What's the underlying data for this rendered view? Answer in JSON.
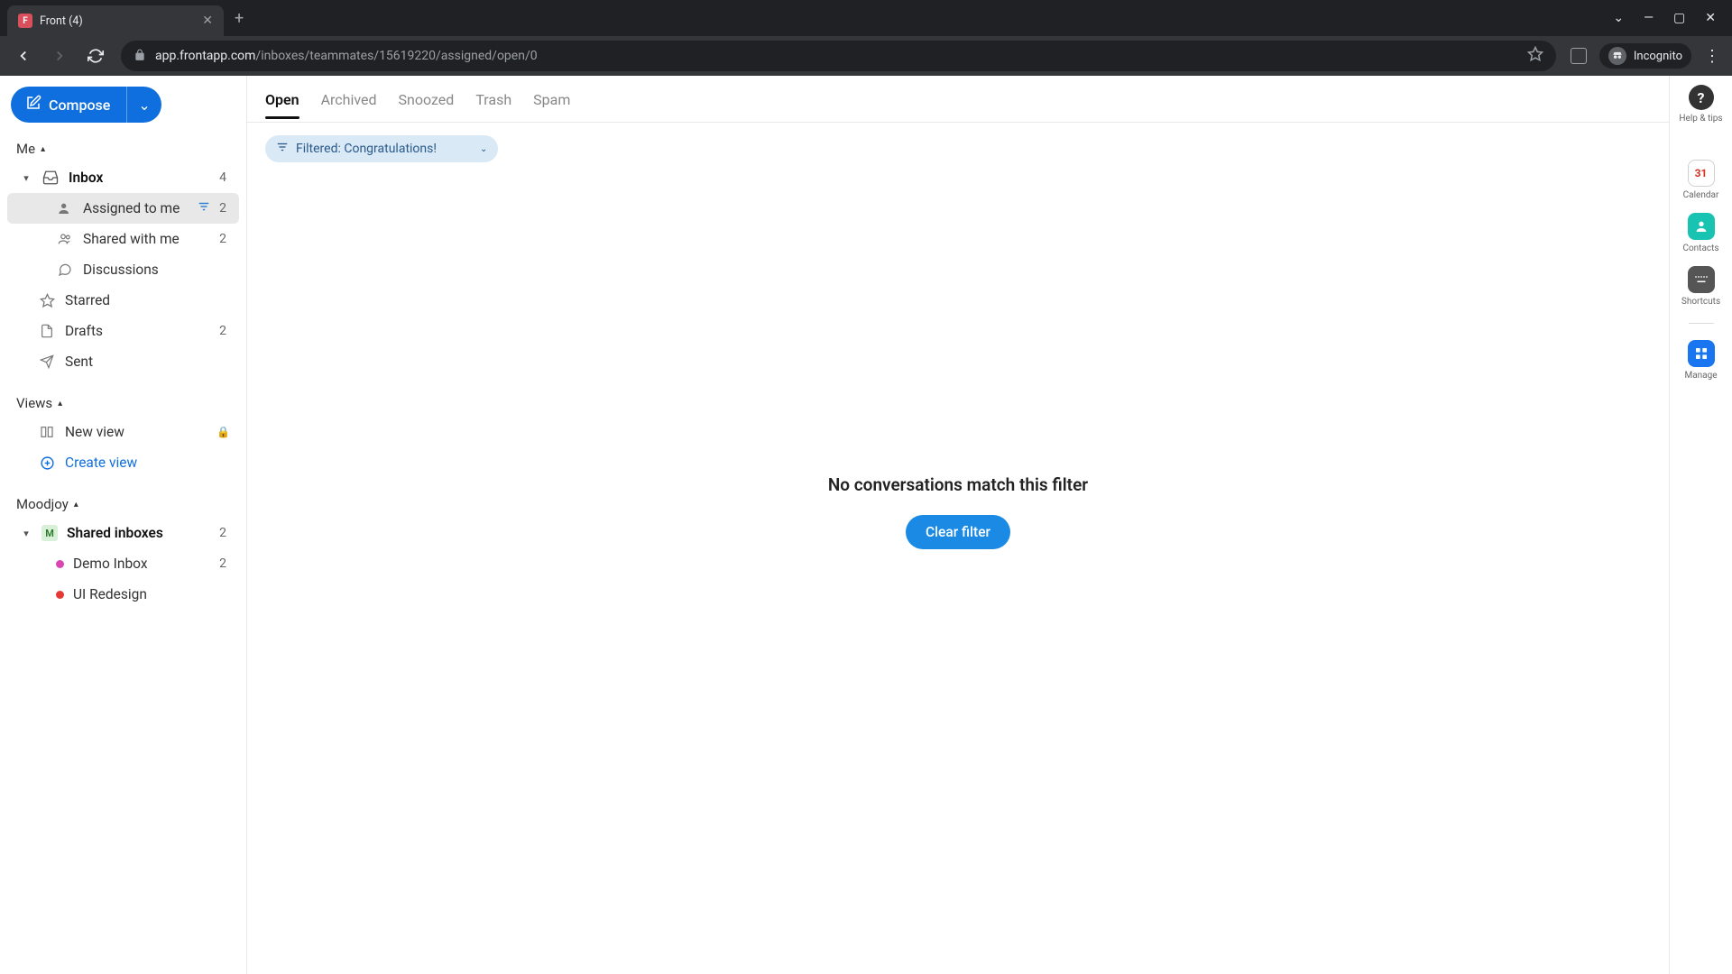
{
  "browser": {
    "tab_title": "Front (4)",
    "url_host": "app.frontapp.com",
    "url_path": "/inboxes/teammates/15619220/assigned/open/0",
    "incognito_label": "Incognito"
  },
  "sidebar": {
    "compose_label": "Compose",
    "sections": {
      "me": {
        "label": "Me"
      },
      "views": {
        "label": "Views"
      },
      "workspace": {
        "label": "Moodjoy"
      }
    },
    "inbox": {
      "label": "Inbox",
      "count": "4"
    },
    "assigned": {
      "label": "Assigned to me",
      "count": "2"
    },
    "shared_with_me": {
      "label": "Shared with me",
      "count": "2"
    },
    "discussions": {
      "label": "Discussions"
    },
    "starred": {
      "label": "Starred"
    },
    "drafts": {
      "label": "Drafts",
      "count": "2"
    },
    "sent": {
      "label": "Sent"
    },
    "new_view": {
      "label": "New view"
    },
    "create_view": {
      "label": "Create view"
    },
    "shared_inboxes": {
      "label": "Shared inboxes",
      "count": "2"
    },
    "demo_inbox": {
      "label": "Demo Inbox",
      "count": "2"
    },
    "ui_redesign": {
      "label": "UI Redesign"
    }
  },
  "main": {
    "tabs": {
      "open": "Open",
      "archived": "Archived",
      "snoozed": "Snoozed",
      "trash": "Trash",
      "spam": "Spam"
    },
    "filter_chip": "Filtered: Congratulations!",
    "empty_message": "No conversations match this filter",
    "clear_filter": "Clear filter"
  },
  "rail": {
    "help": "Help & tips",
    "calendar": "Calendar",
    "calendar_day": "31",
    "contacts": "Contacts",
    "shortcuts": "Shortcuts",
    "manage": "Manage"
  }
}
